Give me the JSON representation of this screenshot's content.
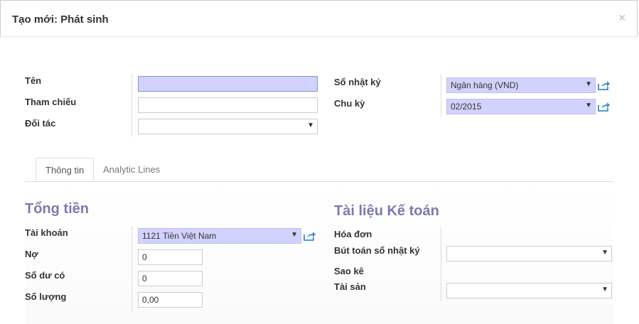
{
  "dialog": {
    "title": "Tạo mới: Phát sinh",
    "close": "×"
  },
  "form": {
    "name_label": "Tên",
    "name_value": "",
    "ref_label": "Tham chiếu",
    "ref_value": "",
    "partner_label": "Đối tác",
    "partner_value": "",
    "journal_label": "Sổ nhật ký",
    "journal_value": "Ngân hàng (VND)",
    "period_label": "Chu kỳ",
    "period_value": "02/2015"
  },
  "tabs": [
    {
      "label": "Thông tin",
      "active": true
    },
    {
      "label": "Analytic Lines",
      "active": false
    }
  ],
  "amounts": {
    "title": "Tổng tiền",
    "account_label": "Tài khoản",
    "account_value": "1121 Tiền Việt Nam",
    "debit_label": "Nợ",
    "debit_value": "0",
    "credit_label": "Số dư có",
    "credit_value": "0",
    "quantity_label": "Số lượng",
    "quantity_value": "0,00"
  },
  "accounting_docs": {
    "title": "Tài liệu Kế toán",
    "invoice_label": "Hóa đơn",
    "journal_entry_label": "Bút toán sổ nhật ký",
    "journal_entry_value": "",
    "statement_label": "Sao kê",
    "asset_label": "Tài sản",
    "asset_value": ""
  },
  "icons": {
    "dropdown": "▼",
    "external": "external-link-icon"
  },
  "colors": {
    "required_bg": "#d2d2ff",
    "section_title": "#7c7bad"
  }
}
